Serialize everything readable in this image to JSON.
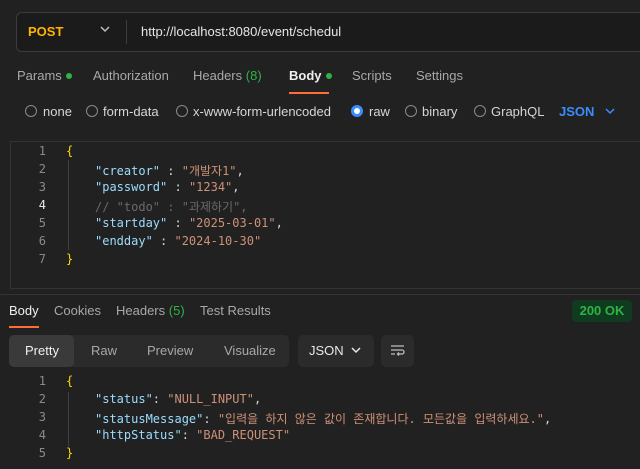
{
  "request": {
    "method": "POST",
    "url": "http://localhost:8080/event/schedul",
    "tabs": [
      {
        "label": "Params",
        "dot": true
      },
      {
        "label": "Authorization"
      },
      {
        "label": "Headers",
        "count": "(8)"
      },
      {
        "label": "Body",
        "dot": true,
        "active": true
      },
      {
        "label": "Scripts"
      },
      {
        "label": "Settings"
      }
    ],
    "body_types": [
      "none",
      "form-data",
      "x-www-form-urlencoded",
      "raw",
      "binary",
      "GraphQL"
    ],
    "selected_body_type": "raw",
    "format": "JSON",
    "code_lines": [
      {
        "n": "1",
        "text": "{"
      },
      {
        "n": "2",
        "key": "\"creator\"",
        "sep": " : ",
        "val": "\"개발자1\"",
        "end": ","
      },
      {
        "n": "3",
        "key": "\"password\"",
        "sep": " : ",
        "val": "\"1234\"",
        "end": ","
      },
      {
        "n": "4",
        "comment": "// \"todo\" : \"과제하기\","
      },
      {
        "n": "5",
        "key": "\"startday\"",
        "sep": " : ",
        "val": "\"2025-03-01\"",
        "end": ","
      },
      {
        "n": "6",
        "key": "\"endday\"",
        "sep": " : ",
        "val": "\"2024-10-30\"",
        "end": ""
      },
      {
        "n": "7",
        "text": "}"
      }
    ]
  },
  "response": {
    "tabs": [
      {
        "label": "Body",
        "active": true
      },
      {
        "label": "Cookies"
      },
      {
        "label": "Headers",
        "count": "(5)"
      },
      {
        "label": "Test Results"
      }
    ],
    "status": "200 OK",
    "view_modes": [
      "Pretty",
      "Raw",
      "Preview",
      "Visualize"
    ],
    "format": "JSON",
    "code_lines": [
      {
        "n": "1",
        "text": "{"
      },
      {
        "n": "2",
        "key": "\"status\"",
        "sep": ": ",
        "val": "\"NULL_INPUT\"",
        "end": ","
      },
      {
        "n": "3",
        "key": "\"statusMessage\"",
        "sep": ": ",
        "val": "\"입력을 하지 않은 값이 존재합니다. 모든값을 입력하세요.\"",
        "end": ","
      },
      {
        "n": "4",
        "key": "\"httpStatus\"",
        "sep": ": ",
        "val": "\"BAD_REQUEST\"",
        "end": ""
      },
      {
        "n": "5",
        "text": "}"
      }
    ]
  },
  "colors": {
    "accent": "#ff6c37",
    "method": "#ffb400",
    "success": "#2fb344",
    "link": "#3a8dff"
  },
  "icons": [
    "chevron-down-icon",
    "radio-icon",
    "word-wrap-icon"
  ]
}
